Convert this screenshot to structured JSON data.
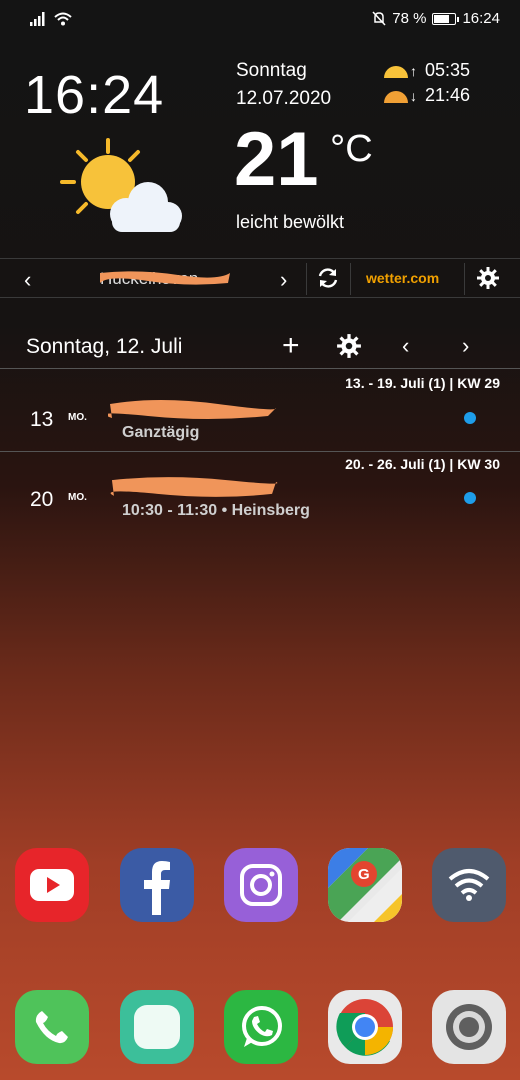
{
  "status_bar": {
    "battery_percent": "78 %",
    "battery_level": 0.78,
    "time": "16:24",
    "icons": [
      "signal-icon",
      "wifi-icon",
      "mute-icon",
      "battery-icon"
    ]
  },
  "weather": {
    "clock": "16:24",
    "day_name": "Sonntag",
    "date": "12.07.2020",
    "temperature": "21",
    "unit": "°C",
    "condition": "leicht bewölkt",
    "sunrise": "05:35",
    "sunset": "21:46",
    "sunrise_arrow": "↑",
    "sunset_arrow": "↓",
    "location": "Hückelhoven",
    "brand": "wetter.com",
    "icon": "partly-cloudy-icon"
  },
  "calendar": {
    "header_title": "Sonntag, 12. Juli",
    "add_label": "+",
    "prev_label": "‹",
    "next_label": "›",
    "weeks": [
      {
        "label": "13. - 19. Juli (1) | KW 29",
        "event": {
          "day": "13",
          "weekday": "MO.",
          "subtitle": "Ganztägig",
          "dot_color": "#1e9de9"
        }
      },
      {
        "label": "20. - 26. Juli (1) | KW 30",
        "event": {
          "day": "20",
          "weekday": "MO.",
          "subtitle": "10:30 - 11:30  •  Heinsberg",
          "dot_color": "#1e9de9"
        }
      }
    ]
  },
  "nav_prev": "‹",
  "nav_next": "›",
  "apps_row1": [
    "YouTube",
    "Facebook",
    "Instagram",
    "Maps",
    "WLAN"
  ],
  "apps_row2": [
    "Telefon",
    "Nachrichten",
    "WhatsApp",
    "Chrome",
    "Kamera"
  ],
  "colors": {
    "accent_blue": "#1e9de9",
    "brand_orange": "#f0a000",
    "redaction": "#f0955a"
  }
}
